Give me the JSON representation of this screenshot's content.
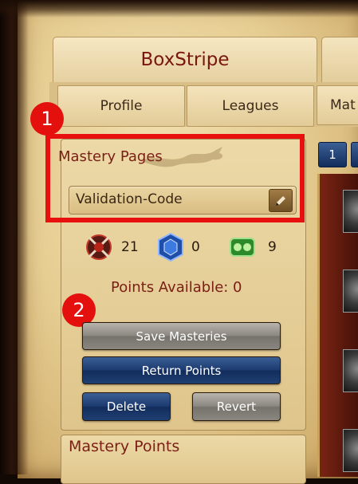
{
  "window": {
    "title": "BoxStripe"
  },
  "nav": {
    "tabs": [
      {
        "label": "Profile"
      },
      {
        "label": "Leagues"
      },
      {
        "label": "Mat"
      }
    ]
  },
  "mastery_pages": {
    "title": "Mastery Pages",
    "selected_page": "Validation-Code",
    "page_numbers": [
      "1"
    ]
  },
  "trees": [
    {
      "icon": "offense-tree-icon",
      "points": "21"
    },
    {
      "icon": "defense-tree-icon",
      "points": "0"
    },
    {
      "icon": "utility-tree-icon",
      "points": "9"
    }
  ],
  "points_available": "Points Available: 0",
  "buttons": {
    "save": "Save Masteries",
    "return": "Return Points",
    "delete": "Delete",
    "revert": "Revert"
  },
  "mastery_points": {
    "title": "Mastery Points"
  },
  "callouts": {
    "one": "1",
    "two": "2"
  },
  "colors": {
    "callout_red": "#e4100e",
    "title_red": "#7b1e16",
    "parchment": "#e6cd92",
    "button_blue": "#1d3b70",
    "button_grey": "#8b8781"
  }
}
